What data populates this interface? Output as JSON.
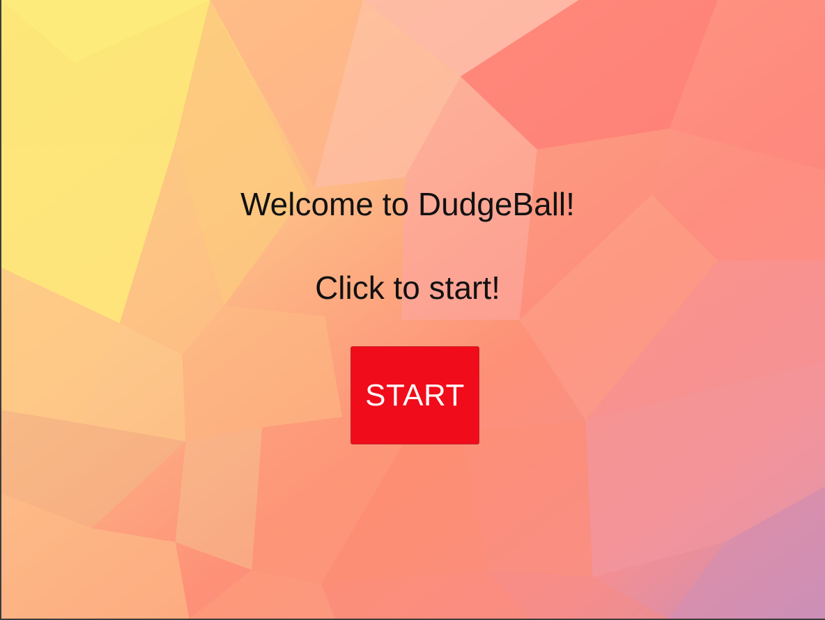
{
  "screen": {
    "welcome_text": "Welcome to DudgeBall!",
    "instruction_text": "Click to start!",
    "start_button_label": "START"
  },
  "colors": {
    "start_button": "#f00c1a",
    "start_button_text": "#ffffff",
    "text": "#111111",
    "background_gradient": [
      "#fce77a",
      "#fdbf86",
      "#fd9277",
      "#fb7e7c",
      "#c98dbb"
    ]
  }
}
